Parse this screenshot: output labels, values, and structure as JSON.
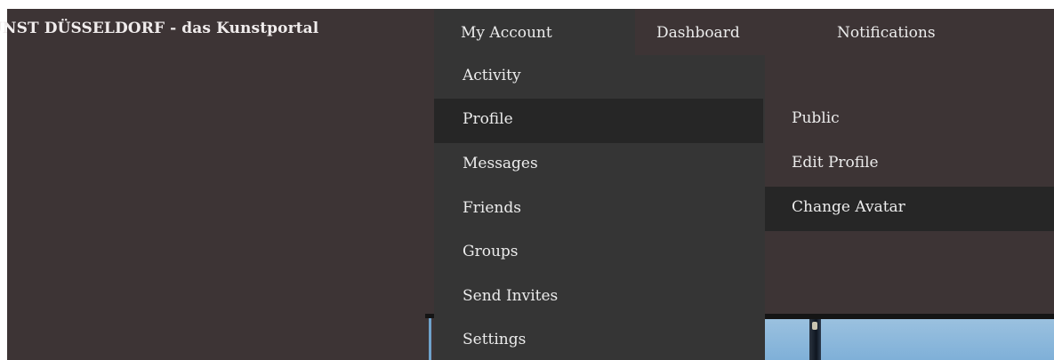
{
  "site": {
    "title": "UNST DÜSSELDORF - das Kunstportal"
  },
  "nav": {
    "my_account": "My Account",
    "dashboard": "Dashboard",
    "notifications": "Notifications"
  },
  "account_menu": {
    "items": [
      {
        "label": "Activity"
      },
      {
        "label": "Profile"
      },
      {
        "label": "Messages"
      },
      {
        "label": "Friends"
      },
      {
        "label": "Groups"
      },
      {
        "label": "Send Invites"
      },
      {
        "label": "Settings"
      }
    ],
    "active_item": "Profile"
  },
  "profile_submenu": {
    "items": [
      {
        "label": "Public"
      },
      {
        "label": "Edit Profile"
      },
      {
        "label": "Change Avatar"
      }
    ],
    "active_item": "Change Avatar"
  },
  "colors": {
    "bar_bg": "#3d3435",
    "menu_bg": "#353535",
    "active_bg": "#262626",
    "text": "#ececec"
  }
}
